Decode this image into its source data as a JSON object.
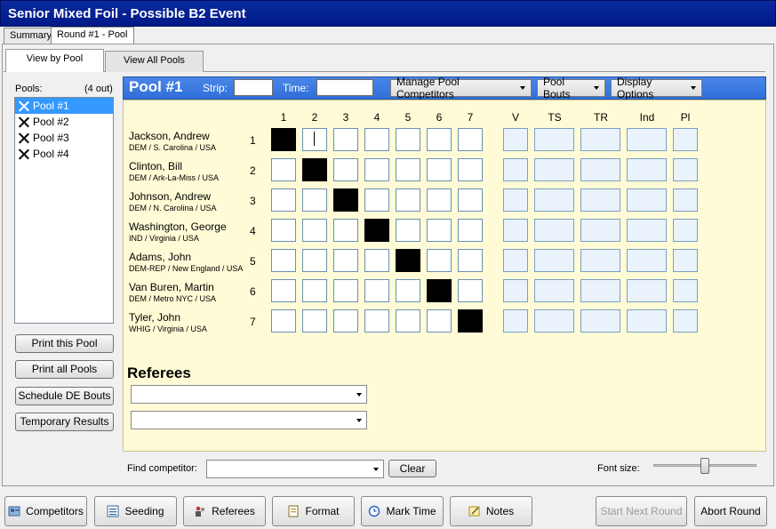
{
  "window": {
    "title": "Senior Mixed Foil - Possible B2 Event"
  },
  "outer_tabs": [
    {
      "label": "Summary",
      "active": false
    },
    {
      "label": "Round #1 - Pool",
      "active": true
    }
  ],
  "inner_tabs": [
    {
      "label": "View by Pool",
      "active": true
    },
    {
      "label": "View All Pools",
      "active": false
    }
  ],
  "pools_panel": {
    "label": "Pools:",
    "count": "(4 out)",
    "items": [
      "Pool #1",
      "Pool #2",
      "Pool #3",
      "Pool #4"
    ],
    "selected": "Pool #1",
    "icon": "crossed-swords-icon"
  },
  "left_buttons": [
    "Print this Pool",
    "Print all Pools",
    "Schedule DE Bouts",
    "Temporary Results"
  ],
  "pool_header": {
    "title": "Pool #1",
    "strip_label": "Strip:",
    "strip_value": "",
    "time_label": "Time:",
    "time_value": "",
    "menus": [
      "Manage Pool Competitors",
      "Pool Bouts",
      "Display Options"
    ]
  },
  "grid": {
    "bout_columns": [
      "1",
      "2",
      "3",
      "4",
      "5",
      "6",
      "7"
    ],
    "result_columns": [
      "V",
      "TS",
      "TR",
      "Ind",
      "Pl"
    ],
    "competitors": [
      {
        "num": "1",
        "name": "Jackson, Andrew",
        "affiliation": "DEM / S. Carolina / USA"
      },
      {
        "num": "2",
        "name": "Clinton, Bill",
        "affiliation": "DEM / Ark-La-Miss / USA"
      },
      {
        "num": "3",
        "name": "Johnson, Andrew",
        "affiliation": "DEM / N. Carolina / USA"
      },
      {
        "num": "4",
        "name": "Washington, George",
        "affiliation": "IND / Virginia / USA"
      },
      {
        "num": "5",
        "name": "Adams, John",
        "affiliation": "DEM-REP / New England / USA"
      },
      {
        "num": "6",
        "name": "Van Buren, Martin",
        "affiliation": "DEM / Metro NYC / USA"
      },
      {
        "num": "7",
        "name": "Tyler, John",
        "affiliation": "WHIG / Virginia / USA"
      }
    ]
  },
  "referees": {
    "heading": "Referees",
    "dropdowns": [
      "",
      ""
    ]
  },
  "find": {
    "label": "Find competitor:",
    "value": "",
    "clear_label": "Clear"
  },
  "font_size": {
    "label": "Font size:",
    "level": 0.5
  },
  "bottom_buttons": [
    {
      "label": "Competitors",
      "icon": "competitors-icon",
      "enabled": true
    },
    {
      "label": "Seeding",
      "icon": "seeding-list-icon",
      "enabled": true
    },
    {
      "label": "Referees",
      "icon": "referees-icon",
      "enabled": true
    },
    {
      "label": "Format",
      "icon": "format-icon",
      "enabled": true
    },
    {
      "label": "Mark Time",
      "icon": "clock-icon",
      "enabled": true
    },
    {
      "label": "Notes",
      "icon": "notes-icon",
      "enabled": true
    },
    {
      "label": "Start Next Round",
      "icon": "",
      "enabled": false
    },
    {
      "label": "Abort Round",
      "icon": "",
      "enabled": true
    }
  ]
}
